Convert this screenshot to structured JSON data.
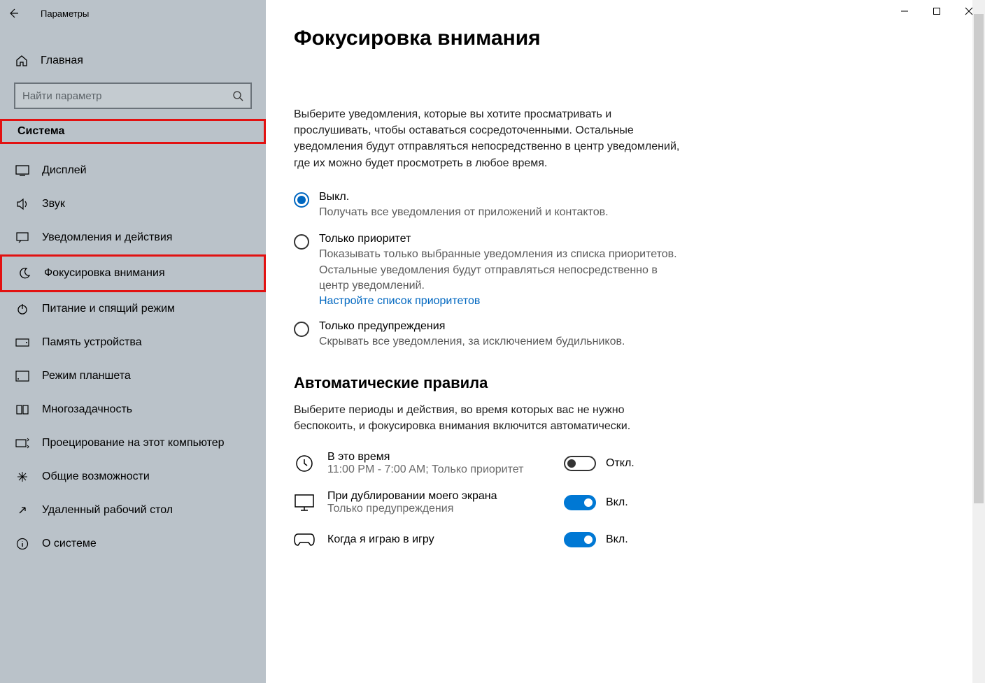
{
  "titlebar": {
    "title": "Параметры"
  },
  "nav": {
    "home": "Главная",
    "search_placeholder": "Найти параметр",
    "category": "Система",
    "items": [
      {
        "label": "Дисплей"
      },
      {
        "label": "Звук"
      },
      {
        "label": "Уведомления и действия"
      },
      {
        "label": "Фокусировка внимания"
      },
      {
        "label": "Питание и спящий режим"
      },
      {
        "label": "Память устройства"
      },
      {
        "label": "Режим планшета"
      },
      {
        "label": "Многозадачность"
      },
      {
        "label": "Проецирование на этот компьютер"
      },
      {
        "label": "Общие возможности"
      },
      {
        "label": "Удаленный рабочий стол"
      },
      {
        "label": "О системе"
      }
    ]
  },
  "page": {
    "title": "Фокусировка внимания",
    "description": "Выберите уведомления, которые вы хотите просматривать и прослушивать, чтобы оставаться сосредоточенными. Остальные уведомления будут отправляться непосредственно в центр уведомлений, где их можно будет просмотреть в любое время.",
    "radios": [
      {
        "label": "Выкл.",
        "sub": "Получать все уведомления от приложений и контактов.",
        "link": ""
      },
      {
        "label": "Только приоритет",
        "sub": "Показывать только выбранные уведомления из списка приоритетов. Остальные уведомления будут отправляться непосредственно в центр уведомлений.",
        "link": "Настройте список приоритетов"
      },
      {
        "label": "Только предупреждения",
        "sub": "Скрывать все уведомления, за исключением будильников.",
        "link": ""
      }
    ],
    "rules_header": "Автоматические правила",
    "rules_desc": "Выберите периоды и действия, во время которых вас не нужно беспокоить, и фокусировка внимания включится автоматически.",
    "rules": [
      {
        "label": "В это время",
        "sub": "11:00 PM - 7:00 AM; Только приоритет",
        "state": "Откл.",
        "on": false
      },
      {
        "label": "При дублировании моего экрана",
        "sub": "Только предупреждения",
        "state": "Вкл.",
        "on": true
      },
      {
        "label": "Когда я играю в игру",
        "sub": "",
        "state": "Вкл.",
        "on": true
      }
    ]
  }
}
